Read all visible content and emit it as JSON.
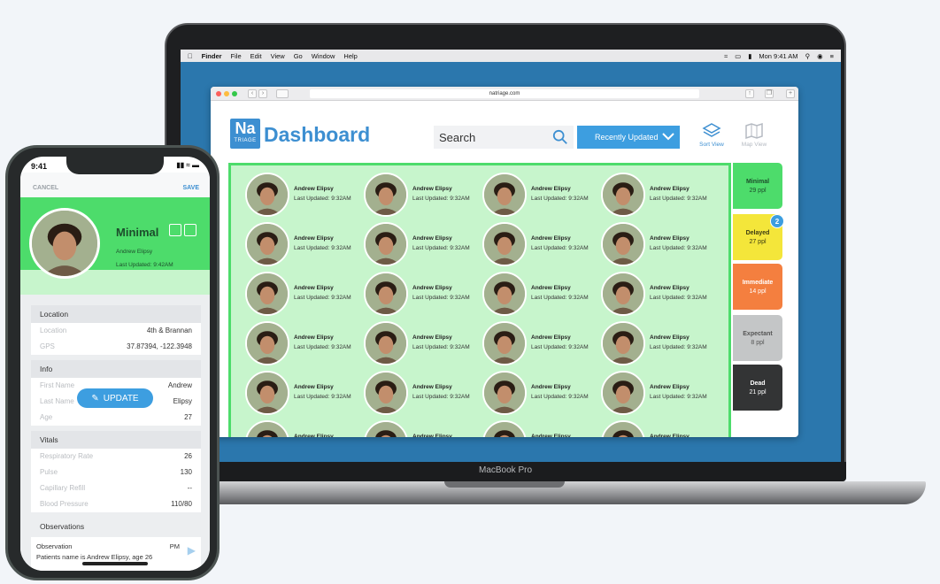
{
  "laptop": {
    "label": "MacBook Pro",
    "menubar": {
      "apple": "",
      "items": [
        "Finder",
        "File",
        "Edit",
        "View",
        "Go",
        "Window",
        "Help"
      ],
      "clock": "Mon 9:41 AM"
    },
    "browser": {
      "url": "natriage.com"
    },
    "app": {
      "logo_main": "Na",
      "logo_sub": "TRIAGE",
      "title": "Dashboard",
      "search_placeholder": "Search",
      "sort_label": "Recently Updated",
      "sort_view_label": "Sort View",
      "map_view_label": "Map View"
    },
    "patients": {
      "name": "Andrew Elipsy",
      "updated": "Last Updated: 9:32AM",
      "rows": 6,
      "cols": 4
    },
    "categories": [
      {
        "name": "Minimal",
        "count": "29 ppl",
        "color": "#4ddc6b",
        "text": "#1d4d2c"
      },
      {
        "name": "Delayed",
        "count": "27 ppl",
        "color": "#f4e63a",
        "text": "#3b3a12"
      },
      {
        "name": "Immediate",
        "count": "14 ppl",
        "color": "#f47f3f",
        "text": "#ffffff"
      },
      {
        "name": "Expectant",
        "count": "8 ppl",
        "color": "#c4c6c7",
        "text": "#555555"
      },
      {
        "name": "Dead",
        "count": "21 ppl",
        "color": "#333435",
        "text": "#ffffff"
      }
    ],
    "delayed_badge": "2"
  },
  "phone": {
    "time": "9:41",
    "cancel": "CANCEL",
    "save": "SAVE",
    "status": "Minimal",
    "patient_name": "Andrew Elipsy",
    "last_updated": "Last Updated: 9:42AM",
    "location": {
      "header": "Location",
      "rows": [
        {
          "k": "Location",
          "v": "4th & Brannan"
        },
        {
          "k": "GPS",
          "v": "37.87394, -122.3948"
        }
      ]
    },
    "info": {
      "header": "Info",
      "rows": [
        {
          "k": "First Name",
          "v": "Andrew"
        },
        {
          "k": "Last Name",
          "v": "Elipsy"
        },
        {
          "k": "Age",
          "v": "27"
        }
      ]
    },
    "vitals": {
      "header": "Vitals",
      "rows": [
        {
          "k": "Respiratory Rate",
          "v": "26"
        },
        {
          "k": "Pulse",
          "v": "130"
        },
        {
          "k": "Capillary Refill",
          "v": "--"
        },
        {
          "k": "Blood Pressure",
          "v": "110/80"
        }
      ]
    },
    "observations": {
      "header": "Observations",
      "line1": "Observation",
      "line1_tail": "PM",
      "line2": "Patients name is Andrew Elipsy, age 26"
    },
    "update_button": "UPDATE"
  },
  "colors": {
    "accent": "#3d8fd1",
    "minimal_green": "#4ddc6b",
    "grid_bg": "#c7f5cc"
  }
}
